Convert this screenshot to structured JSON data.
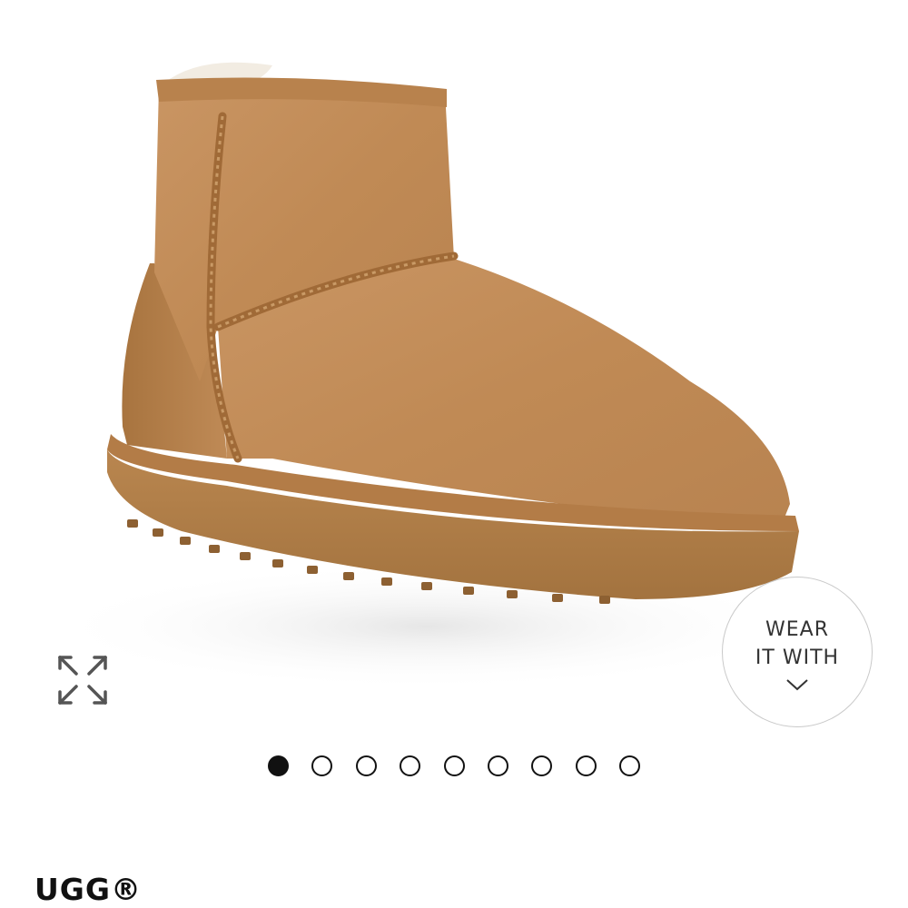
{
  "product": {
    "brand": "UGG®",
    "image_alt": "Chestnut suede mini boot"
  },
  "wear_it_with": {
    "line1": "WEAR",
    "line2": "IT WITH"
  },
  "gallery": {
    "dot_count": 9,
    "active_index": 0
  },
  "icons": {
    "expand": "expand-arrows-icon",
    "chevron": "chevron-down-icon"
  },
  "colors": {
    "boot_suede": "#c08a55",
    "sole": "#b07e4c",
    "dot_active": "#111111"
  }
}
